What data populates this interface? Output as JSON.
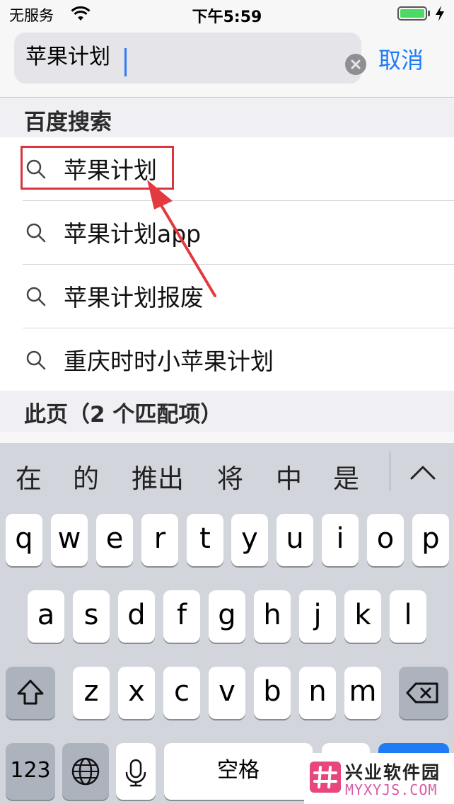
{
  "status_bar": {
    "carrier": "无服务",
    "time": "下午5:59"
  },
  "search": {
    "query": "苹果计划",
    "cancel_label": "取消"
  },
  "sections": {
    "baidu_title": "百度搜索",
    "page_title": "此页（2 个匹配项）"
  },
  "suggestions": [
    "苹果计划",
    "苹果计划app",
    "苹果计划报废",
    "重庆时时小苹果计划"
  ],
  "keyboard": {
    "candidates": [
      "在",
      "的",
      "推出",
      "将",
      "中",
      "是"
    ],
    "row1": [
      "q",
      "w",
      "e",
      "r",
      "t",
      "y",
      "u",
      "i",
      "o",
      "p"
    ],
    "row2": [
      "a",
      "s",
      "d",
      "f",
      "g",
      "h",
      "j",
      "k",
      "l"
    ],
    "row3": [
      "z",
      "x",
      "c",
      "v",
      "b",
      "n",
      "m"
    ],
    "numbers_label": "123",
    "space_label": "空格"
  },
  "watermark": {
    "title": "兴业软件园",
    "url": "MYXYJS.COM"
  },
  "colors": {
    "accent": "#1f7cf5",
    "highlight_box": "#d9363e",
    "keyboard_bg": "#d2d5db"
  }
}
